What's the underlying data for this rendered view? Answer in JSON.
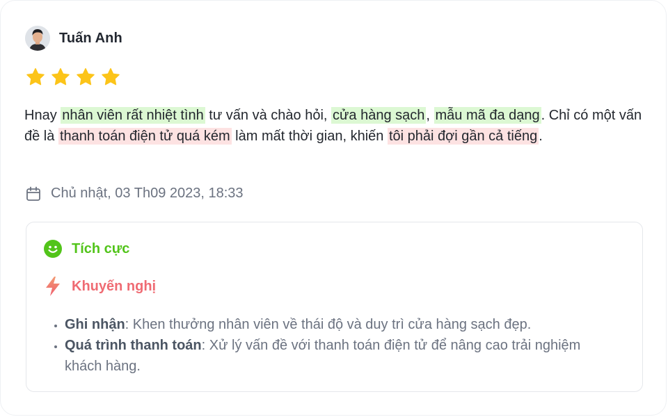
{
  "reviewer": {
    "name": "Tuấn Anh",
    "avatar_icon": "user-avatar"
  },
  "rating": {
    "stars": 4,
    "max": 4,
    "color": "#fcc419"
  },
  "review": {
    "segments": [
      {
        "text": "Hnay ",
        "tone": "none"
      },
      {
        "text": "nhân viên rất nhiệt tình",
        "tone": "positive"
      },
      {
        "text": " tư vấn và chào hỏi, ",
        "tone": "none"
      },
      {
        "text": "cửa hàng sạch",
        "tone": "positive"
      },
      {
        "text": ", ",
        "tone": "none"
      },
      {
        "text": "mẫu mã đa dạng",
        "tone": "positive"
      },
      {
        "text": ". Chỉ có một vấn đề là ",
        "tone": "none"
      },
      {
        "text": "thanh toán điện tử quá kém",
        "tone": "negative"
      },
      {
        "text": " làm mất thời gian, khiến ",
        "tone": "none"
      },
      {
        "text": "tôi phải đợi gần cả tiếng",
        "tone": "negative"
      },
      {
        "text": ".",
        "tone": "none"
      }
    ]
  },
  "date": {
    "icon": "calendar-icon",
    "text": "Chủ nhật, 03 Th09 2023, 18:33"
  },
  "analysis": {
    "sentiment": {
      "icon": "smile-icon",
      "label": "Tích cực",
      "color": "#52c41a"
    },
    "recommendation": {
      "icon": "lightning-icon",
      "label": "Khuyến nghị",
      "color": "#ef6b73"
    },
    "items": [
      {
        "key": "Ghi nhận",
        "text": ": Khen thưởng nhân viên về thái độ và duy trì cửa hàng sạch đẹp."
      },
      {
        "key": "Quá trình thanh toán",
        "text": ": Xử lý vấn đề với thanh toán điện tử để nâng cao trải nghiệm khách hàng."
      }
    ]
  }
}
